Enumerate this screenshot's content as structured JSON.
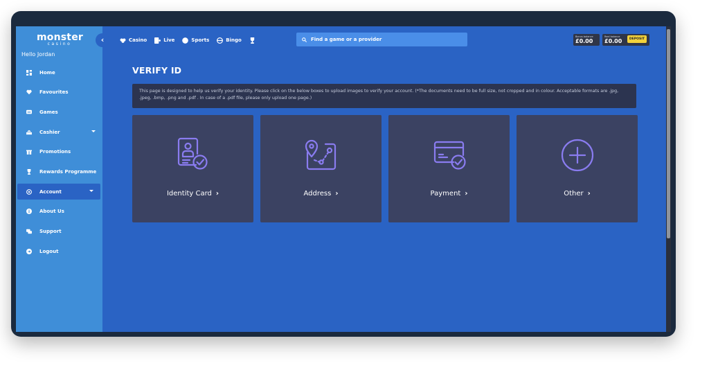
{
  "brand": {
    "name": "monster",
    "sub": "casino"
  },
  "greeting": "Hello Jordan",
  "sidebar": {
    "items": [
      {
        "label": "Home",
        "icon": "home-icon"
      },
      {
        "label": "Favourites",
        "icon": "heart-icon"
      },
      {
        "label": "Games",
        "icon": "games-icon"
      },
      {
        "label": "Cashier",
        "icon": "cashier-icon",
        "dropdown": true
      },
      {
        "label": "Promotions",
        "icon": "gift-icon"
      },
      {
        "label": "Rewards Programme",
        "icon": "trophy-icon"
      },
      {
        "label": "Account",
        "icon": "account-icon",
        "dropdown": true,
        "active": true
      },
      {
        "label": "About Us",
        "icon": "info-icon"
      },
      {
        "label": "Support",
        "icon": "support-icon"
      },
      {
        "label": "Logout",
        "icon": "logout-icon"
      }
    ]
  },
  "collapse_glyph": "‹",
  "topnav": {
    "items": [
      {
        "label": "Casino",
        "icon": "casino-icon"
      },
      {
        "label": "Live",
        "icon": "live-icon"
      },
      {
        "label": "Sports",
        "icon": "sports-icon"
      },
      {
        "label": "Bingo",
        "icon": "bingo-icon"
      }
    ],
    "trophy_icon": "trophy-icon"
  },
  "search": {
    "placeholder": "Find a game or a provider",
    "icon": "search-icon"
  },
  "balances": {
    "bonus": {
      "label": "Bonus balance",
      "value": "£0.00"
    },
    "real": {
      "label": "Real balance",
      "value": "£0.00"
    },
    "deposit_label": "DEPOSIT"
  },
  "page": {
    "title": "VERIFY ID",
    "notice": "This page is designed to help us verify your identity. Please click on the below boxes to upload images to verify your account. (*The documents need to be full size, not cropped and in colour. Acceptable formats are .jpg, .jpeg, .bmp, .png and .pdf . In case of a .pdf file, please only upload one page.)"
  },
  "cards": [
    {
      "label": "Identity Card",
      "icon": "identity-card-icon"
    },
    {
      "label": "Address",
      "icon": "address-map-icon"
    },
    {
      "label": "Payment",
      "icon": "payment-card-icon"
    },
    {
      "label": "Other",
      "icon": "plus-circle-icon"
    }
  ],
  "colors": {
    "sidebar": "#3f8ed8",
    "main": "#2a63c4",
    "card": "#3b4262",
    "icon_accent": "#8a7cf0",
    "deposit": "#f3d23b"
  }
}
